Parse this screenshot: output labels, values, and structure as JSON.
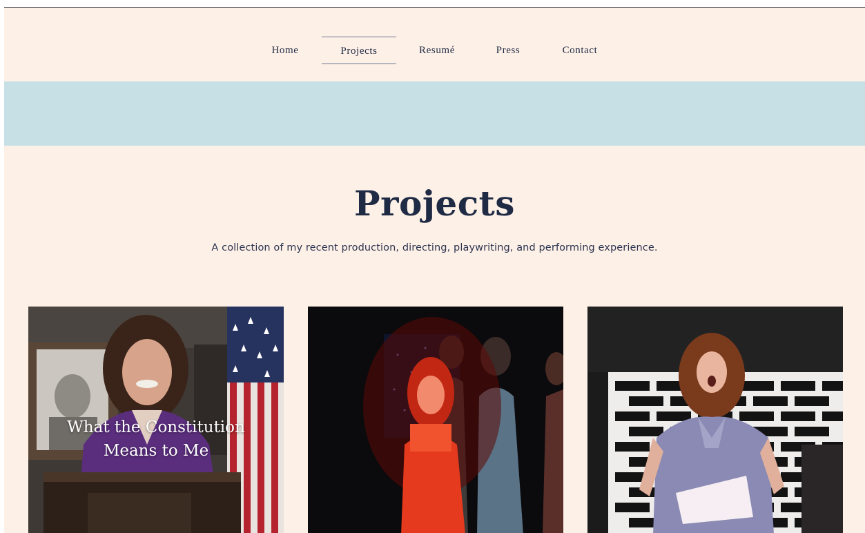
{
  "nav": {
    "items": [
      {
        "label": "Home"
      },
      {
        "label": "Projects",
        "active": true
      },
      {
        "label": "Resumé"
      },
      {
        "label": "Press"
      },
      {
        "label": "Contact"
      }
    ]
  },
  "colors": {
    "background": "#fdf0e7",
    "banner": "#c6e0e6",
    "text": "#1f2a44"
  },
  "main": {
    "title": "Projects",
    "subtitle": "A collection of my recent production, directing, playwriting, and performing experience."
  },
  "projects": [
    {
      "caption_line1": "What the Constitution",
      "caption_line2": "Means to Me",
      "image": "woman-at-podium-photo"
    },
    {
      "image": "singer-in-red-light-photo"
    },
    {
      "image": "performer-singing-brick-wall-photo"
    }
  ]
}
